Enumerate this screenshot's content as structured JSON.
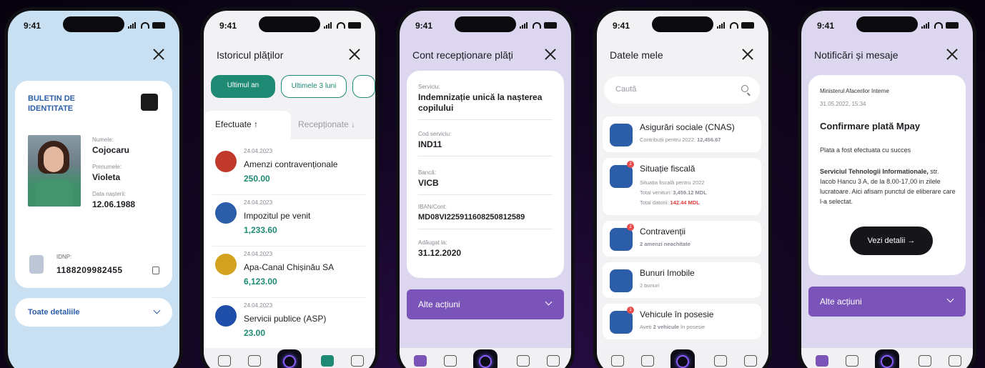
{
  "status": {
    "time": "9:41"
  },
  "identity": {
    "title": "BULETIN DE IDENTITATE",
    "last_name_label": "Numele:",
    "last_name": "Cojocaru",
    "first_name_label": "Prenumele:",
    "first_name": "Violeta",
    "birth_label": "Data nașterii:",
    "birth": "12.06.1988",
    "idnp_label": "IDNP:",
    "idnp": "1188209982455",
    "details_label": "Toate detaliile"
  },
  "history": {
    "title": "Istoricul plăților",
    "filter_last_year": "Ultimul an",
    "filter_last_3_months": "Ultimele 3 luni",
    "tab_done": "Efectuate ↑",
    "tab_received": "Recepționate ↓",
    "payments": [
      {
        "date": "24.04.2023",
        "name": "Amenzi contravenționale",
        "amount": "250.00",
        "color": "#c0392b"
      },
      {
        "date": "24.04.2023",
        "name": "Impozitul pe venit",
        "amount": "1,233.60",
        "color": "#2b5da9"
      },
      {
        "date": "24.04.2023",
        "name": "Apa-Canal Chișinău SA",
        "amount": "6,123.00",
        "color": "#d4a21f"
      },
      {
        "date": "24.04.2023",
        "name": "Servicii publice (ASP)",
        "amount": "23.00",
        "color": "#1f4ea8"
      }
    ]
  },
  "receipt": {
    "title": "Cont recepționare plăți",
    "service_label": "Serviciu:",
    "service": "Indemnizație unică la nașterea copilului",
    "code_label": "Cod serviciu:",
    "code": "IND11",
    "bank_label": "Bancă:",
    "bank": "VICB",
    "iban_label": "IBAN/Cont:",
    "iban": "MD08VI225911608250812589",
    "added_label": "Adăugat la:",
    "added": "31.12.2020",
    "actions": "Alte acțiuni"
  },
  "mydata": {
    "title": "Datele mele",
    "search_placeholder": "Caută",
    "items": [
      {
        "name": "Asigurări sociale (CNAS)",
        "sub": "Contribuții pentru 2022:",
        "sub_value": "12,456.67"
      },
      {
        "name": "Situație fiscală",
        "sub": "Situația fiscală pentru 2022",
        "line2": "Total venituri:",
        "line2_value": "3,459.12 MDL",
        "line3": "Total datorii:",
        "line3_value": "142.44 MDL",
        "badge": "2"
      },
      {
        "name": "Contravenții",
        "sub_value": "2 amenzi neachitate",
        "badge": "2"
      },
      {
        "name": "Bunuri Imobile",
        "sub": "2 bunuri"
      },
      {
        "name": "Vehicule în posesie",
        "sub": "Aveți",
        "sub_value": "2 vehicule",
        "sub_after": "în posesie",
        "badge": "1"
      }
    ]
  },
  "notifications": {
    "title": "Notificări și mesaje",
    "source": "Ministerul Afacerilor Interne",
    "date": "31.05.2022, 15:34",
    "heading": "Confirmare plată Mpay",
    "line1": "Plata a fost efectuata cu succes",
    "bold": "Serviciul Tehnologii Informationale,",
    "body": "str. Iacob Hancu 3 A, de la 8.00-17,00 in zilele lucratoare. Aici afisam punctul de eliberare care l-a selectat.",
    "button": "Vezi detalii →",
    "actions": "Alte acțiuni"
  }
}
